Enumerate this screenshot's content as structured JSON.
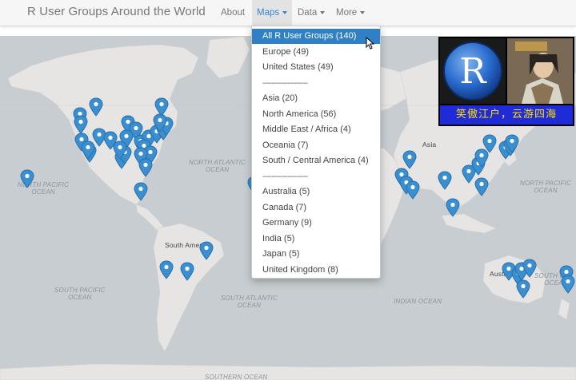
{
  "navbar": {
    "brand": "R User Groups Around the World",
    "items": [
      {
        "label": "About",
        "has_caret": false,
        "active": false
      },
      {
        "label": "Maps",
        "has_caret": true,
        "active": true
      },
      {
        "label": "Data",
        "has_caret": true,
        "active": false
      },
      {
        "label": "More",
        "has_caret": true,
        "active": false
      }
    ]
  },
  "dropdown": {
    "items": [
      {
        "label": "All R User Groups (140)",
        "active": true
      },
      {
        "label": "Europe (49)"
      },
      {
        "label": "United States (49)"
      },
      {
        "label": "--------------------",
        "separator": true
      },
      {
        "label": "Asia (20)"
      },
      {
        "label": "North America (56)"
      },
      {
        "label": "Middle East / Africa (4)"
      },
      {
        "label": "Oceania (7)"
      },
      {
        "label": "South / Central America (4)"
      },
      {
        "label": "--------------------",
        "separator": true
      },
      {
        "label": "Australia (5)"
      },
      {
        "label": "Canada (7)"
      },
      {
        "label": "Germany (9)"
      },
      {
        "label": "India (5)"
      },
      {
        "label": "Japan (5)"
      },
      {
        "label": "United Kingdom (8)"
      }
    ]
  },
  "map": {
    "labels": {
      "north_atlantic": "NORTH ATLANTIC\nOCEAN",
      "north_pacific_west": "NORTH PACIFIC\nOCEAN",
      "north_pacific_east": "NORTH PACIFIC\nOCEAN",
      "south_pacific": "SOUTH PACIFIC\nOCEAN",
      "south_atlantic": "SOUTH ATLANTIC\nOCEAN",
      "indian": "INDIAN OCEAN",
      "southern": "SOUTHERN OCEAN",
      "south_pacific_east": "SOUTH PAC\nOCEA",
      "south_america": "South America",
      "asia": "Asia",
      "australia": "Austra"
    },
    "colors": {
      "water": "#c7cdd0",
      "land": "#e6e5e3",
      "pin": "#3a8fd1",
      "pin_dark": "#2a6fa8"
    }
  },
  "ad": {
    "logo_letter": "R",
    "caption": "笑傲江户，云游四海"
  }
}
